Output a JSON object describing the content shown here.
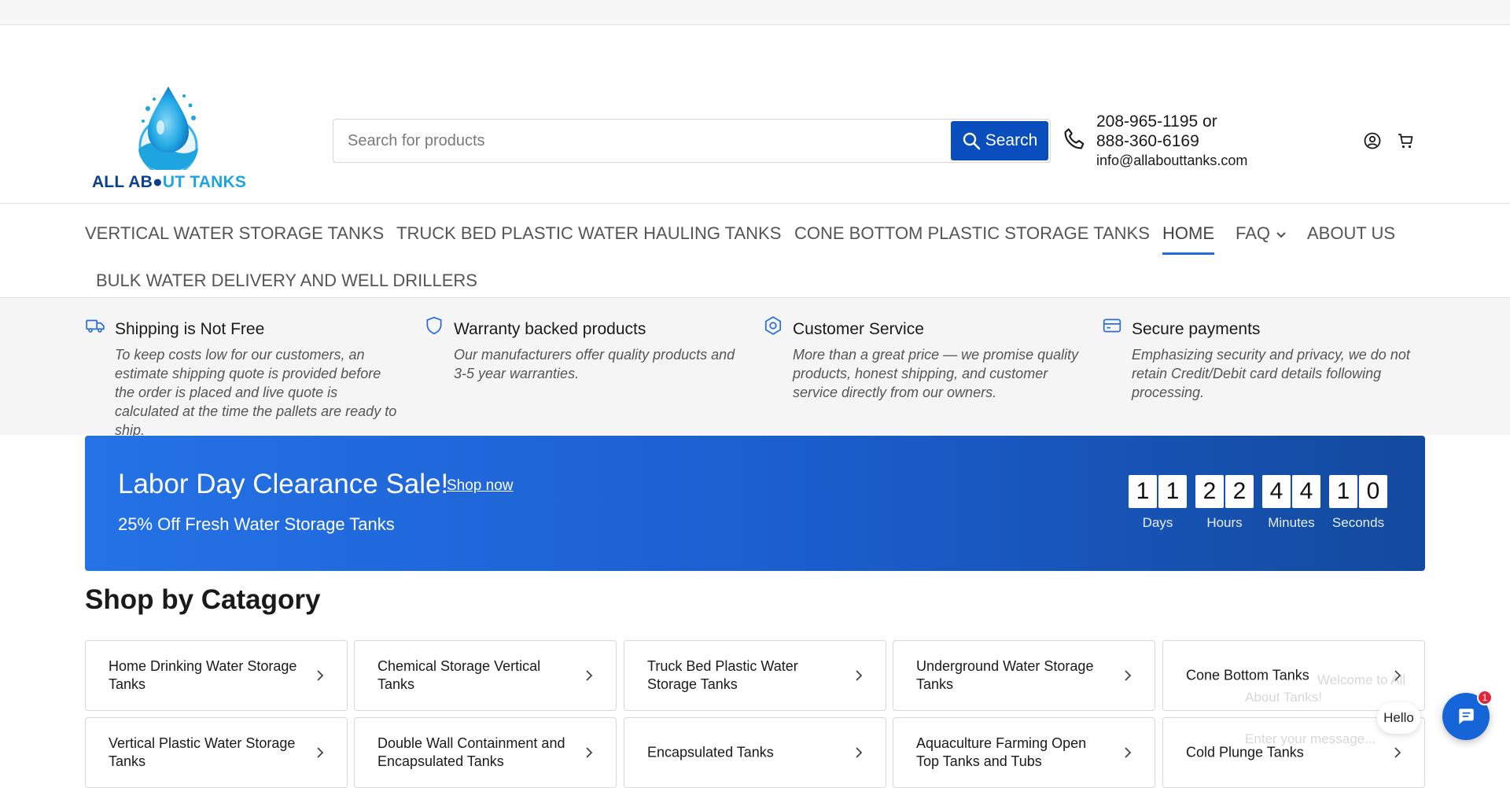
{
  "brand": {
    "logo_text_part1": "ALL AB",
    "logo_text_part2": "UT TANKS",
    "colors": {
      "dark_blue": "#0d3f8f",
      "light_blue": "#1ea5e0",
      "primary": "#0a4ebd",
      "accent_underline": "#1e6fd9"
    }
  },
  "search": {
    "placeholder": "Search for products",
    "button_label": "Search",
    "icon": "search-icon"
  },
  "contact": {
    "phone_line1": "208-965-1195 or",
    "phone_line2": "888-360-6169",
    "email": "info@allabouttanks.com",
    "icon": "phone-icon"
  },
  "header_icons": {
    "account": "account-icon",
    "cart": "cart-icon"
  },
  "nav": {
    "items": [
      {
        "label": "VERTICAL WATER STORAGE TANKS"
      },
      {
        "label": "TRUCK BED PLASTIC WATER HAULING TANKS"
      },
      {
        "label": "CONE BOTTOM PLASTIC STORAGE TANKS"
      },
      {
        "label": "HOME",
        "active": true
      },
      {
        "label": "FAQ",
        "has_dropdown": true
      },
      {
        "label": "ABOUT US"
      },
      {
        "label": "BULK WATER DELIVERY AND WELL DRILLERS"
      }
    ]
  },
  "features": [
    {
      "icon": "truck-icon",
      "title": "Shipping is Not Free",
      "text": "To keep costs low for our customers, an estimate shipping quote is provided before the order is placed and live quote is calculated at the time the pallets are ready to ship."
    },
    {
      "icon": "shield-icon",
      "title": "Warranty backed products",
      "text": "Our manufacturers offer quality products and 3-5 year warranties."
    },
    {
      "icon": "service-badge-icon",
      "title": "Customer Service",
      "text": "More than a great price — we promise quality products, honest shipping, and customer service directly from our owners."
    },
    {
      "icon": "credit-card-icon",
      "title": "Secure payments",
      "text": "Emphasizing security and privacy, we do not retain Credit/Debit card details following processing."
    }
  ],
  "sale": {
    "title": "Labor Day Clearance Sale!",
    "link_label": "Shop now",
    "subtitle": "25% Off Fresh Water Storage Tanks",
    "countdown": {
      "days": [
        "1",
        "1"
      ],
      "days_label": "Days",
      "hours": [
        "2",
        "2"
      ],
      "hours_label": "Hours",
      "minutes": [
        "4",
        "4"
      ],
      "minutes_label": "Minutes",
      "seconds": [
        "1",
        "0"
      ],
      "seconds_label": "Seconds"
    }
  },
  "categories": {
    "title": "Shop by Catagory",
    "items": [
      "Home Drinking Water Storage Tanks",
      "Chemical Storage Vertical Tanks",
      "Truck Bed Plastic Water Storage Tanks",
      "Underground Water Storage Tanks",
      "Cone Bottom Tanks",
      "Vertical Plastic Water Storage Tanks",
      "Double Wall Containment and Encapsulated Tanks",
      "Encapsulated Tanks",
      "Aquaculture Farming Open Top Tanks and Tubs",
      "Cold Plunge Tanks"
    ]
  },
  "chat": {
    "bubble_text": "Hello",
    "badge_count": "1",
    "ghost_welcome_line1": "Welcome to All",
    "ghost_welcome_line2": "About Tanks!",
    "ghost_input_placeholder": "Enter your message..."
  }
}
